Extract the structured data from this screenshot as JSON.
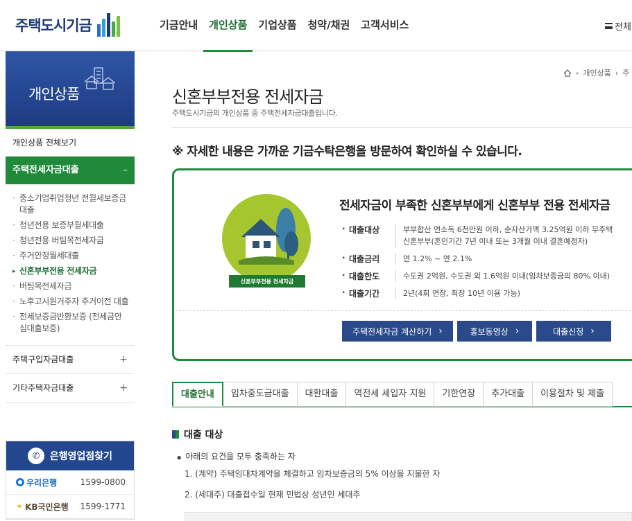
{
  "header": {
    "logo_text": "주택도시기금",
    "nav": [
      "기금안내",
      "개인상품",
      "기업상품",
      "청약/채권",
      "고객서비스"
    ],
    "active_nav": "개인상품",
    "all_menu_label": "전체"
  },
  "sidebar": {
    "banner_title": "개인상품",
    "all_view": "개인상품 전체보기",
    "active_group": "주택전세자금대출",
    "active_group_toggle": "–",
    "sub_items": [
      "중소기업취업청년 전월세보증금대출",
      "청년전용 보증부월세대출",
      "청년전용 버팀목전세자금",
      "주거안정월세대출",
      "신혼부부전용 전세자금",
      "버팀목전세자금",
      "노후고시원거주자 주거이전 대출",
      "전세보증금반환보증 (전세금안심대출보증)"
    ],
    "current_sub": "신혼부부전용 전세자금",
    "groups": [
      {
        "label": "주택구입자금대출",
        "toggle": "+"
      },
      {
        "label": "기타주택자금대출",
        "toggle": "+"
      }
    ]
  },
  "bank_finder": {
    "title": "은행영업점찾기",
    "banks": [
      {
        "name": "우리은행",
        "tel": "1599-0800"
      },
      {
        "name": "KB국민은행",
        "tel": "1599-1771"
      }
    ]
  },
  "breadcrumb": [
    "개인상품",
    "주"
  ],
  "page": {
    "title": "신혼부부전용 전세자금",
    "subtitle": "주택도시기금의 개인상품 중 주택전세자금대출입니다.",
    "notice": "※ 자세한 내용은 가까운 기금수탁은행을 방문하여 확인하실 수 있습니다."
  },
  "product": {
    "badge_label": "신혼부부전용 전세자금",
    "headline": "전세자금이 부족한 신혼부부에게 신혼부부 전용 전세자금",
    "info": [
      {
        "label": "대출대상",
        "lines": [
          "부부합산 연소득 6천만원 이하, 순자산가액 3.25억원 이하 무주택",
          "신혼부부(혼인기간 7년 이내 또는 3개월 이내 결혼예정자)"
        ]
      },
      {
        "label": "대출금리",
        "lines": [
          "연 1.2% ~ 연 2.1%"
        ]
      },
      {
        "label": "대출한도",
        "lines": [
          "수도권 2억원, 수도권 외 1.6억원 이내(임차보증금의 80% 이내)"
        ]
      },
      {
        "label": "대출기간",
        "lines": [
          "2년(4회 연장, 최장 10년 이용 가능)"
        ]
      }
    ],
    "buttons": [
      "주택전세자금 계산하기",
      "홍보동영상",
      "대출신청"
    ]
  },
  "tabs": [
    "대출안내",
    "임차중도금대출",
    "대환대출",
    "역전세 세입자 지원",
    "기한연장",
    "추가대출",
    "이용절차 및 제출"
  ],
  "active_tab": "대출안내",
  "section": {
    "title": "대출 대상",
    "intro": "아래의 요건을 모두 충족하는 자",
    "items": [
      "1. (계약) 주택임대차계약을 체결하고 임차보증금의 5% 이상을 지불한 자",
      "2. (세대주) 대출접수일 현재 민법상 성년인 세대주"
    ]
  }
}
